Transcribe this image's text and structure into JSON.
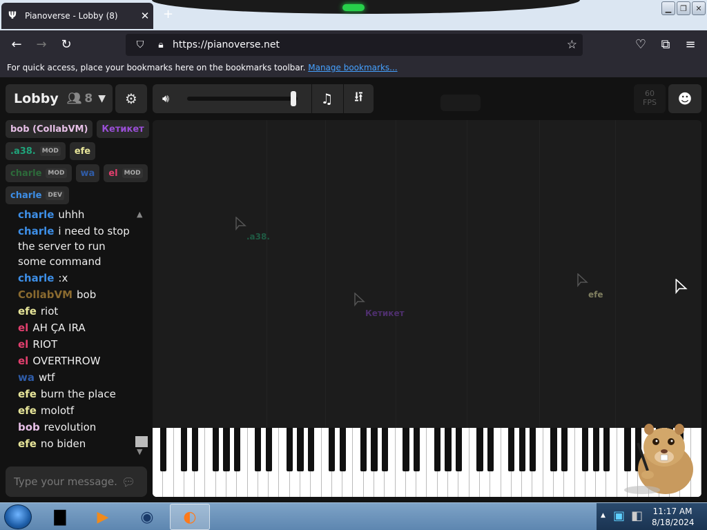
{
  "browser": {
    "tab_title": "Pianoverse - Lobby (8)",
    "tab_close": "✕",
    "new_tab": "+",
    "url": "https://pianoverse.net",
    "bookmarks_text": "For quick access, place your bookmarks here on the bookmarks toolbar.",
    "bookmarks_link": "Manage bookmarks..."
  },
  "header": {
    "lobby": "Lobby",
    "user_count": "8",
    "fps_value": "60",
    "fps_label": "FPS"
  },
  "users": [
    [
      {
        "name": "bob (CollabVM)",
        "color": "#e6bfe6"
      },
      {
        "name": "Кетикет",
        "color": "#9a4fd6"
      }
    ],
    [
      {
        "name": ".a38.",
        "color": "#1fa37a",
        "badge": "MOD"
      },
      {
        "name": "efe",
        "color": "#e8e69a"
      }
    ],
    [
      {
        "name": "charle",
        "color": "#2d6a3a",
        "badge": "MOD"
      },
      {
        "name": "wa",
        "color": "#2f5ca8"
      },
      {
        "name": "el",
        "color": "#e23f6e",
        "badge": "MOD"
      }
    ],
    [
      {
        "name": "charle",
        "color": "#3d8ee6",
        "badge": "DEV"
      }
    ]
  ],
  "chat": [
    {
      "name": "charle",
      "color": "#3d8ee6",
      "text": "uhhh"
    },
    {
      "name": "charle",
      "color": "#3d8ee6",
      "text": "i need to stop the server to run some command"
    },
    {
      "name": "charle",
      "color": "#3d8ee6",
      "text": ":x"
    },
    {
      "name": "CollabVM",
      "color": "#8a6a2f",
      "text": "bob"
    },
    {
      "name": "efe",
      "color": "#e8e69a",
      "text": "riot"
    },
    {
      "name": "el",
      "color": "#e23f6e",
      "text": "AH ÇA IRA"
    },
    {
      "name": "el",
      "color": "#e23f6e",
      "text": "RIOT"
    },
    {
      "name": "el",
      "color": "#e23f6e",
      "text": "OVERTHROW"
    },
    {
      "name": "wa",
      "color": "#2f5ca8",
      "text": "wtf"
    },
    {
      "name": "efe",
      "color": "#e8e69a",
      "text": "burn the place"
    },
    {
      "name": "efe",
      "color": "#e8e69a",
      "text": "molotf"
    },
    {
      "name": "bob",
      "color": "#e6bfe6",
      "text": "revolution"
    },
    {
      "name": "efe",
      "color": "#e8e69a",
      "text": "no biden"
    }
  ],
  "chat_input": {
    "placeholder": "Type your message..."
  },
  "cursors": [
    {
      "label": ".a38.",
      "color": "#1f5a43"
    },
    {
      "label": "Кетикет",
      "color": "#4e2f6d"
    },
    {
      "label": "efe",
      "color": "#807f60"
    }
  ],
  "taskbar": {
    "time": "11:17 AM",
    "date": "8/18/2024"
  },
  "colors": {
    "page_bg": "#121212",
    "panel_bg": "#2a2a2a",
    "link": "#45a1ff"
  }
}
